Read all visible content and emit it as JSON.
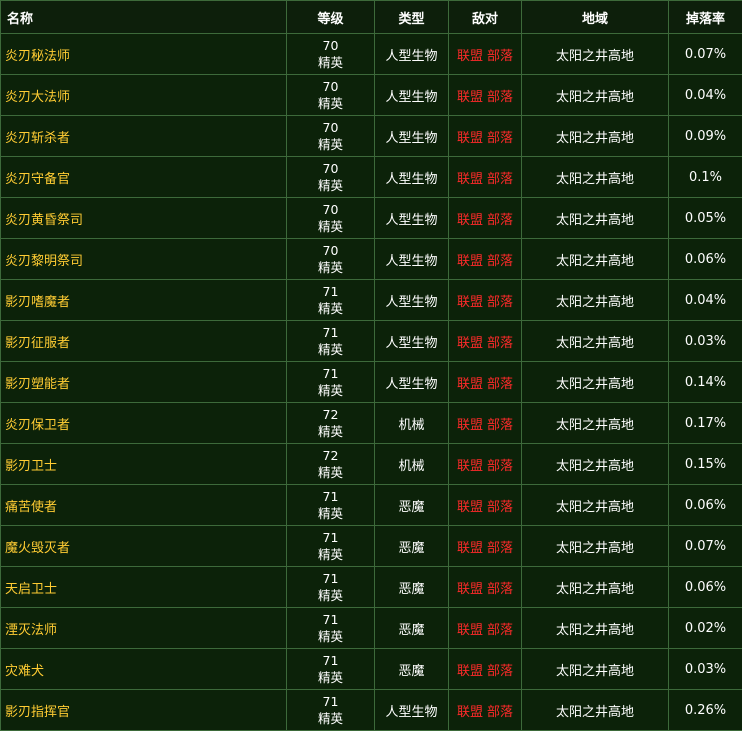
{
  "headers": {
    "name": "名称",
    "level": "等级",
    "type": "类型",
    "hostile": "敌对",
    "zone": "地域",
    "drop_rate": "掉落率"
  },
  "colors": {
    "background": "#0c2209",
    "border": "#3d6a3a",
    "name_text": "#ffcc33",
    "faction_text": "#ff2a2a",
    "text": "#ffffff"
  },
  "rows": [
    {
      "name": "炎刃秘法师",
      "level": "70",
      "rank": "精英",
      "type": "人型生物",
      "alliance": "联盟",
      "horde": "部落",
      "zone": "太阳之井高地",
      "rate": "0.07%"
    },
    {
      "name": "炎刃大法师",
      "level": "70",
      "rank": "精英",
      "type": "人型生物",
      "alliance": "联盟",
      "horde": "部落",
      "zone": "太阳之井高地",
      "rate": "0.04%"
    },
    {
      "name": "炎刃斩杀者",
      "level": "70",
      "rank": "精英",
      "type": "人型生物",
      "alliance": "联盟",
      "horde": "部落",
      "zone": "太阳之井高地",
      "rate": "0.09%"
    },
    {
      "name": "炎刃守备官",
      "level": "70",
      "rank": "精英",
      "type": "人型生物",
      "alliance": "联盟",
      "horde": "部落",
      "zone": "太阳之井高地",
      "rate": "0.1%"
    },
    {
      "name": "炎刃黄昏祭司",
      "level": "70",
      "rank": "精英",
      "type": "人型生物",
      "alliance": "联盟",
      "horde": "部落",
      "zone": "太阳之井高地",
      "rate": "0.05%"
    },
    {
      "name": "炎刃黎明祭司",
      "level": "70",
      "rank": "精英",
      "type": "人型生物",
      "alliance": "联盟",
      "horde": "部落",
      "zone": "太阳之井高地",
      "rate": "0.06%"
    },
    {
      "name": "影刃嗜魔者",
      "level": "71",
      "rank": "精英",
      "type": "人型生物",
      "alliance": "联盟",
      "horde": "部落",
      "zone": "太阳之井高地",
      "rate": "0.04%"
    },
    {
      "name": "影刃征服者",
      "level": "71",
      "rank": "精英",
      "type": "人型生物",
      "alliance": "联盟",
      "horde": "部落",
      "zone": "太阳之井高地",
      "rate": "0.03%"
    },
    {
      "name": "影刃塑能者",
      "level": "71",
      "rank": "精英",
      "type": "人型生物",
      "alliance": "联盟",
      "horde": "部落",
      "zone": "太阳之井高地",
      "rate": "0.14%"
    },
    {
      "name": "炎刃保卫者",
      "level": "72",
      "rank": "精英",
      "type": "机械",
      "alliance": "联盟",
      "horde": "部落",
      "zone": "太阳之井高地",
      "rate": "0.17%"
    },
    {
      "name": "影刃卫士",
      "level": "72",
      "rank": "精英",
      "type": "机械",
      "alliance": "联盟",
      "horde": "部落",
      "zone": "太阳之井高地",
      "rate": "0.15%"
    },
    {
      "name": "痛苦使者",
      "level": "71",
      "rank": "精英",
      "type": "恶魔",
      "alliance": "联盟",
      "horde": "部落",
      "zone": "太阳之井高地",
      "rate": "0.06%"
    },
    {
      "name": "魔火毁灭者",
      "level": "71",
      "rank": "精英",
      "type": "恶魔",
      "alliance": "联盟",
      "horde": "部落",
      "zone": "太阳之井高地",
      "rate": "0.07%"
    },
    {
      "name": "天启卫士",
      "level": "71",
      "rank": "精英",
      "type": "恶魔",
      "alliance": "联盟",
      "horde": "部落",
      "zone": "太阳之井高地",
      "rate": "0.06%"
    },
    {
      "name": "湮灭法师",
      "level": "71",
      "rank": "精英",
      "type": "恶魔",
      "alliance": "联盟",
      "horde": "部落",
      "zone": "太阳之井高地",
      "rate": "0.02%"
    },
    {
      "name": "灾难犬",
      "level": "71",
      "rank": "精英",
      "type": "恶魔",
      "alliance": "联盟",
      "horde": "部落",
      "zone": "太阳之井高地",
      "rate": "0.03%"
    },
    {
      "name": "影刃指挥官",
      "level": "71",
      "rank": "精英",
      "type": "人型生物",
      "alliance": "联盟",
      "horde": "部落",
      "zone": "太阳之井高地",
      "rate": "0.26%"
    }
  ]
}
